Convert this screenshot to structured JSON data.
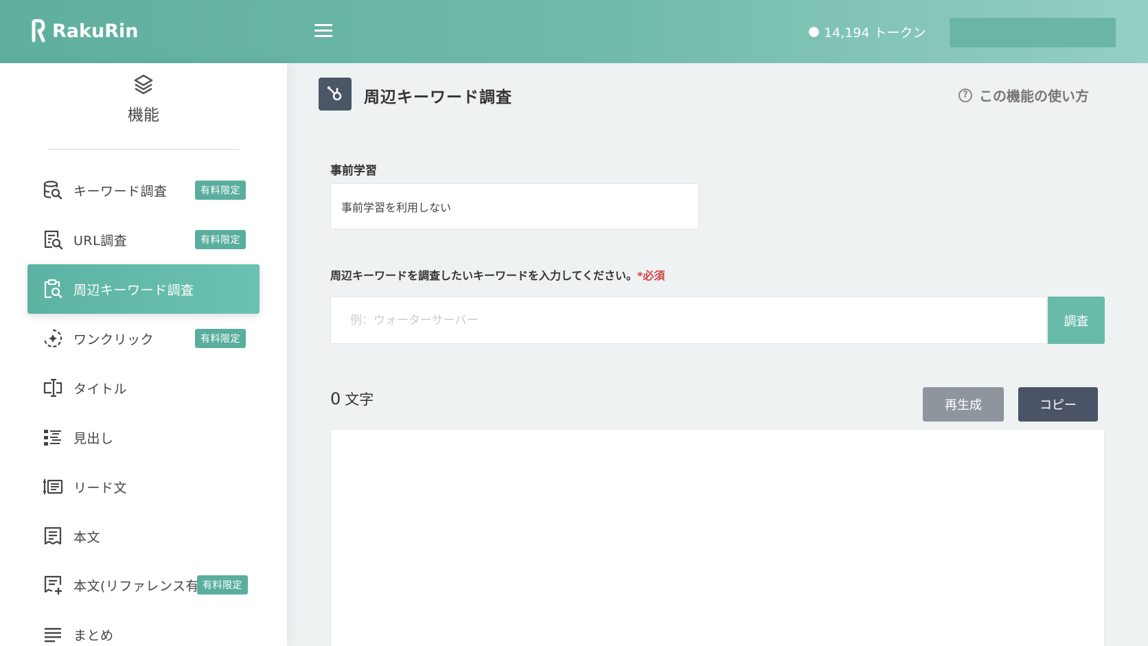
{
  "header": {
    "logo_text": "RakuRin",
    "token_text": "14,194 トークン",
    "colors": {
      "primary": "#5faf9e",
      "accent": "#68bba8"
    }
  },
  "sidebar": {
    "heading": "機能",
    "items": [
      {
        "label": "キーワード調査",
        "badge": "有料限定",
        "icon": "keyword-search-icon"
      },
      {
        "label": "URL調査",
        "badge": "有料限定",
        "icon": "url-search-icon"
      },
      {
        "label": "周辺キーワード調査",
        "badge": "",
        "icon": "related-keyword-icon",
        "active": true
      },
      {
        "label": "ワンクリック",
        "badge": "有料限定",
        "icon": "one-click-icon"
      },
      {
        "label": "タイトル",
        "badge": "",
        "icon": "title-icon"
      },
      {
        "label": "見出し",
        "badge": "",
        "icon": "headings-icon"
      },
      {
        "label": "リード文",
        "badge": "",
        "icon": "lead-text-icon"
      },
      {
        "label": "本文",
        "badge": "",
        "icon": "body-text-icon"
      },
      {
        "label": "本文(リファレンス有)",
        "badge": "有料限定",
        "icon": "body-reference-icon"
      },
      {
        "label": "まとめ",
        "badge": "",
        "icon": "summary-icon"
      }
    ]
  },
  "main": {
    "title": "周辺キーワード調査",
    "howto": "この機能の使い方",
    "pretraining_label": "事前学習",
    "pretraining_value": "事前学習を利用しない",
    "keyword_label": "周辺キーワードを調査したいキーワードを入力してください。",
    "required_mark": "*必須",
    "keyword_placeholder": "例：ウォーターサーバー",
    "search_button": "調査",
    "char_count": "0",
    "char_unit": "文字",
    "regenerate_button": "再生成",
    "copy_button": "コピー"
  }
}
